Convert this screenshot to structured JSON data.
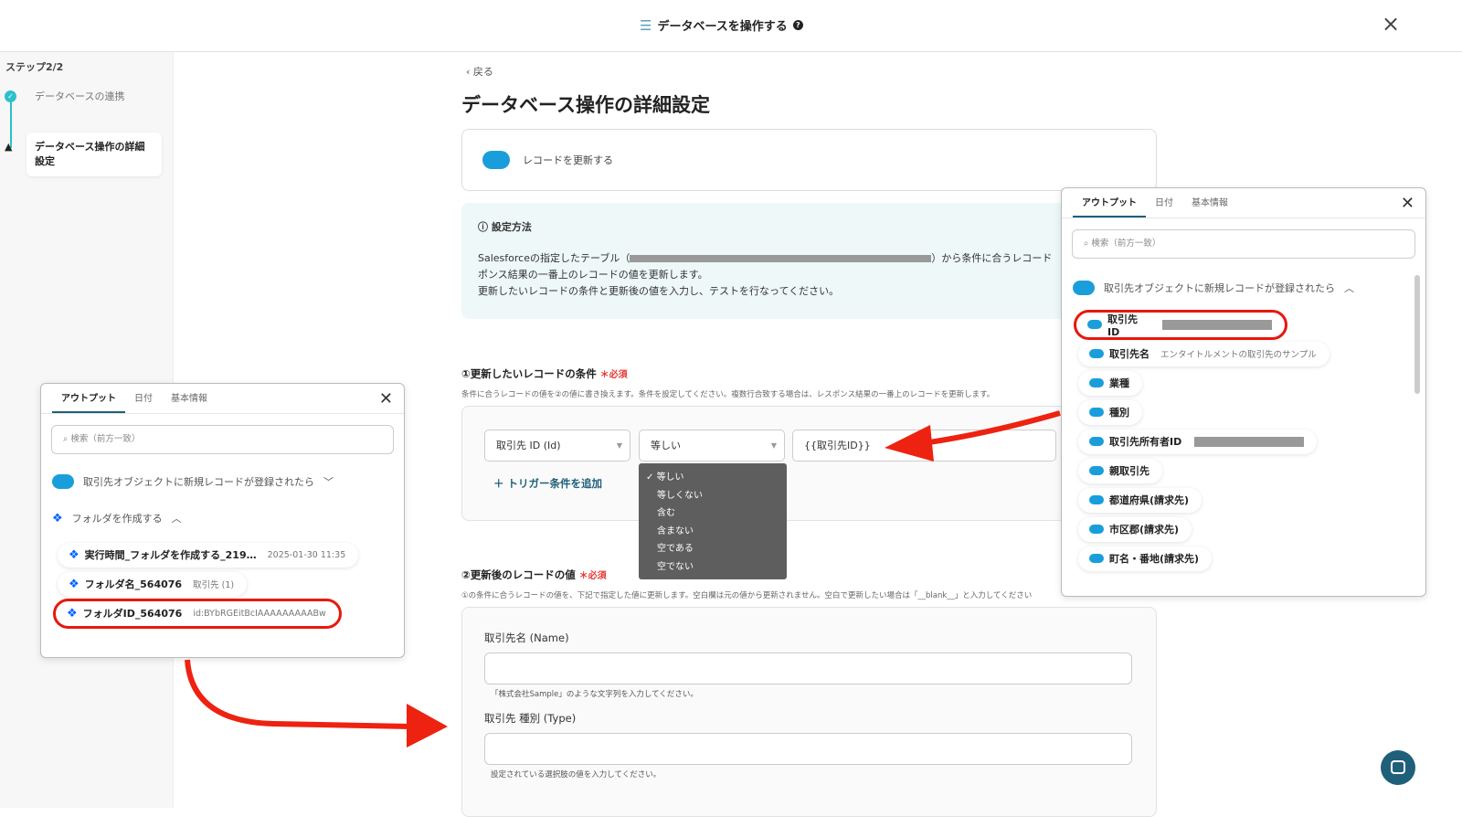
{
  "header": {
    "title": "データベースを操作する",
    "help_icon": "?",
    "close": "×"
  },
  "sidebar": {
    "step": "ステップ2/2",
    "items": [
      {
        "label": "データベースの連携",
        "state": "done"
      },
      {
        "label": "データベース操作の詳細設定",
        "state": "warning"
      }
    ]
  },
  "main": {
    "back": "戻る",
    "title": "データベース操作の詳細設定",
    "action": "レコードを更新する",
    "info": {
      "title": "設定方法",
      "line1_a": "Salesforceの指定したテーブル（",
      "line1_b": "）から条件に合うレコード",
      "line2": "ポンス結果の一番上のレコードの値を更新します。",
      "line3": "更新したいレコードの条件と更新後の値を入力し、テストを行なってください。"
    },
    "section1": {
      "title": "①更新したいレコードの条件",
      "required": "＊必須",
      "desc": "条件に合うレコードの値を②の値に書き換えます。条件を設定してください。複数行合致する場合は、レスポンス結果の一番上のレコードを更新します。",
      "field": "取引先 ID (Id)",
      "operator": "等しい",
      "value": "{{取引先ID}}",
      "add": "トリガー条件を追加"
    },
    "operator_menu": [
      "等しい",
      "等しくない",
      "含む",
      "含まない",
      "空である",
      "空でない"
    ],
    "section2": {
      "title": "②更新後のレコードの値",
      "required": "＊必須",
      "desc": "①の条件に合うレコードの値を、下記で指定した値に更新します。空白欄は元の値から更新されません。空白で更新したい場合は「__blank__」と入力してください",
      "fields": [
        {
          "label": "取引先名 (Name)",
          "value": "",
          "hint": "「株式会社Sample」のような文字列を入力してください。"
        },
        {
          "label": "取引先 種別 (Type)",
          "value": "",
          "hint": "設定されている選択肢の値を入力してください。"
        }
      ]
    }
  },
  "right_popup": {
    "tabs": [
      "アウトプット",
      "日付",
      "基本情報"
    ],
    "search_placeholder": "検索（前方一致）",
    "group": "取引先オブジェクトに新規レコードが登録されたら",
    "items": [
      {
        "label": "取引先ID",
        "value": ""
      },
      {
        "label": "取引先名",
        "value": "エンタイトルメントの取引先のサンプル"
      },
      {
        "label": "業種",
        "value": ""
      },
      {
        "label": "種別",
        "value": ""
      },
      {
        "label": "取引先所有者ID",
        "value": ""
      },
      {
        "label": "親取引先",
        "value": ""
      },
      {
        "label": "都道府県(請求先)",
        "value": ""
      },
      {
        "label": "市区郡(請求先)",
        "value": ""
      },
      {
        "label": "町名・番地(請求先)",
        "value": ""
      }
    ]
  },
  "left_popup": {
    "tabs": [
      "アウトプット",
      "日付",
      "基本情報"
    ],
    "search_placeholder": "検索（前方一致）",
    "group1": "取引先オブジェクトに新規レコードが登録されたら",
    "group2": "フォルダを作成する",
    "items": [
      {
        "label": "実行時間_フォルダを作成する_219…",
        "value": "2025-01-30 11:35"
      },
      {
        "label": "フォルダ名_564076",
        "value": "取引先 (1)"
      },
      {
        "label": "フォルダID_564076",
        "value": "id:BYbRGEitBcIAAAAAAAAABw"
      }
    ]
  },
  "colors": {
    "accent": "#1f5f7a",
    "highlight": "#e8180c",
    "salesforce": "#1a9edb",
    "dropbox": "#0061fe"
  }
}
